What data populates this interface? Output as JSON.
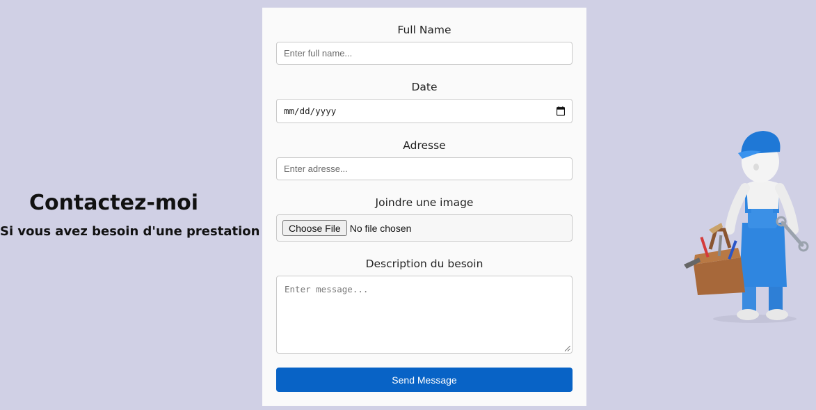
{
  "intro": {
    "title": "Contactez-moi",
    "subtitle": "Si vous avez besoin d'une prestation"
  },
  "form": {
    "full_name": {
      "label": "Full Name",
      "placeholder": "Enter full name..."
    },
    "date": {
      "label": "Date",
      "placeholder": "mm/dd/yyyy",
      "icon": "calendar-icon"
    },
    "address": {
      "label": "Adresse",
      "placeholder": "Enter adresse..."
    },
    "image": {
      "label": "Joindre une image",
      "button_label": "Choose File",
      "status": "No file chosen"
    },
    "description": {
      "label": "Description du besoin",
      "placeholder": "Enter message..."
    },
    "submit_label": "Send Message"
  },
  "illustration": {
    "name": "handyman-with-toolbox"
  },
  "colors": {
    "background": "#d0d0e5",
    "card": "#fafafa",
    "primary": "#0863c6"
  }
}
